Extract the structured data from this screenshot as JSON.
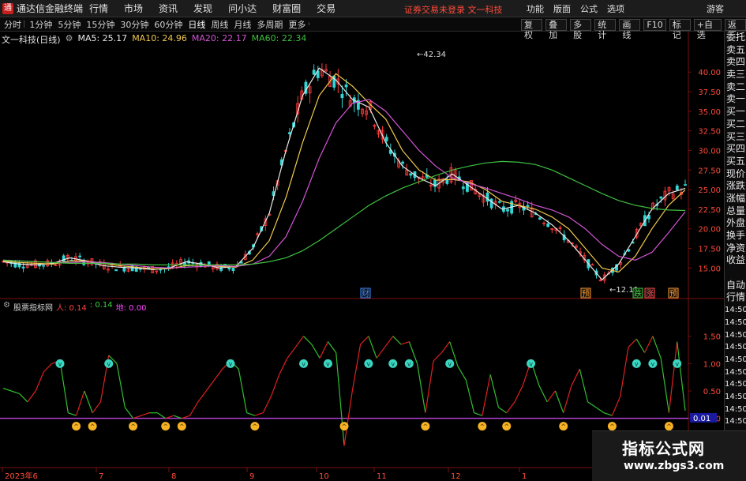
{
  "app": {
    "title": "通达信金融终端",
    "logo": "通"
  },
  "menu": [
    "行情",
    "市场",
    "资讯",
    "发现",
    "问小达",
    "财富圈",
    "交易"
  ],
  "login_warning": "证券交易未登录  文一科技",
  "right_menu": [
    "功能",
    "版面",
    "公式",
    "选项"
  ],
  "guest": "游客",
  "period_tabs": [
    "分时",
    "1分钟",
    "5分钟",
    "15分钟",
    "30分钟",
    "60分钟",
    "日线",
    "周线",
    "月线",
    "多周期",
    "更多"
  ],
  "active_period": "日线",
  "toolbar_buttons": [
    "复权",
    "叠加",
    "多股",
    "统计",
    "画线",
    "F10",
    "标记",
    "+自选",
    "返回"
  ],
  "stock": {
    "name": "文一科技(日线)"
  },
  "ma": {
    "ma5": "MA5: 25.17",
    "ma10": "MA10: 24.96",
    "ma20": "MA20: 22.17",
    "ma60": "MA60: 22.34"
  },
  "indicator": {
    "name": "股票指标网",
    "ren_label": "人: 0.14",
    "value2": ": 0.14",
    "di_label": "地: 0.00"
  },
  "side_panel": [
    "委托",
    "卖五",
    "卖四",
    "卖三",
    "卖二",
    "卖一",
    "买一",
    "买二",
    "买三",
    "买四",
    "买五",
    "现价",
    "涨跌",
    "涨幅",
    "总量",
    "外盘",
    "换手",
    "净资",
    "收益",
    "",
    "自动",
    "行情",
    "14:50",
    "14:50",
    "14:50",
    "14:50",
    "14:50",
    "14:50",
    "14:50",
    "14:50",
    "14:50",
    "14:50"
  ],
  "price_axis": [
    "40.00",
    "37.50",
    "35.00",
    "32.50",
    "30.00",
    "27.50",
    "25.00",
    "22.50",
    "20.00",
    "17.50",
    "15.00"
  ],
  "ind_axis": [
    "1.50",
    "1.00",
    "0.50",
    "0.00",
    "-0.50"
  ],
  "current_ind_value": "0.01",
  "high_label": "42.34",
  "low_label": "12.11",
  "event_tags": [
    "财",
    "预",
    "跌",
    "涨",
    "预"
  ],
  "time_axis": [
    "2023年6",
    "7",
    "8",
    "9",
    "10",
    "11",
    "12",
    "1"
  ],
  "watermark": {
    "title": "指标公式网",
    "url": "www.zbgs3.com"
  },
  "colors": {
    "up": "#ff3b3b",
    "down": "#33d6d6",
    "ma5": "#e8e8e8",
    "ma10": "#f2c94c",
    "ma20": "#d455d6",
    "ma60": "#3fbf3f",
    "signal_purple": "#b040d0"
  },
  "chart_data": [
    {
      "type": "candlestick",
      "title": "文一科技(日线)",
      "ylim": [
        12.11,
        42.34
      ],
      "y_ticks": [
        15,
        17.5,
        20,
        22.5,
        25,
        27.5,
        30,
        32.5,
        35,
        37.5,
        40
      ],
      "x_ticks": [
        "2023年6",
        "7",
        "8",
        "9",
        "10",
        "11",
        "12",
        "1"
      ],
      "series": [
        {
          "name": "MA5",
          "values": [
            15.8,
            15.5,
            15.4,
            15.6,
            16.3,
            15.9,
            15.3,
            15.1,
            15.0,
            14.8,
            15.0,
            15.8,
            15.5,
            15.0,
            15.2,
            17.5,
            22.0,
            30.0,
            37.0,
            40.5,
            39.0,
            36.5,
            35.5,
            31.0,
            28.0,
            26.5,
            25.5,
            27.0,
            25.5,
            24.0,
            22.5,
            23.0,
            22.0,
            20.5,
            18.5,
            16.0,
            13.5,
            15.5,
            19.0,
            22.5,
            24.5,
            25.17
          ]
        },
        {
          "name": "MA10",
          "values": [
            15.9,
            15.7,
            15.6,
            15.5,
            15.9,
            15.9,
            15.6,
            15.3,
            15.1,
            14.9,
            14.9,
            15.3,
            15.4,
            15.2,
            15.1,
            16.0,
            18.5,
            24.0,
            31.0,
            37.0,
            39.8,
            38.2,
            36.0,
            34.0,
            30.0,
            27.5,
            26.2,
            26.3,
            26.0,
            25.0,
            23.5,
            23.0,
            22.5,
            21.5,
            20.0,
            17.5,
            15.0,
            14.5,
            16.5,
            20.0,
            23.0,
            24.96
          ]
        },
        {
          "name": "MA20",
          "values": [
            16.0,
            15.9,
            15.8,
            15.7,
            15.7,
            15.8,
            15.7,
            15.5,
            15.3,
            15.1,
            15.0,
            15.1,
            15.2,
            15.3,
            15.2,
            15.5,
            16.5,
            19.0,
            23.5,
            29.0,
            33.5,
            36.0,
            36.5,
            35.0,
            32.5,
            30.0,
            28.0,
            26.5,
            25.8,
            25.2,
            24.5,
            23.8,
            23.0,
            22.4,
            21.5,
            20.0,
            18.0,
            16.5,
            16.0,
            17.0,
            19.5,
            22.17
          ]
        },
        {
          "name": "MA60",
          "values": [
            16.0,
            15.9,
            15.8,
            15.7,
            15.6,
            15.6,
            15.6,
            15.5,
            15.5,
            15.4,
            15.4,
            15.4,
            15.4,
            15.4,
            15.4,
            15.5,
            15.8,
            16.3,
            17.2,
            18.5,
            20.0,
            21.5,
            23.0,
            24.2,
            25.2,
            26.0,
            26.8,
            27.5,
            28.0,
            28.4,
            28.6,
            28.5,
            28.2,
            27.5,
            26.5,
            25.5,
            24.5,
            23.6,
            23.0,
            22.6,
            22.4,
            22.34
          ]
        }
      ]
    },
    {
      "type": "line",
      "title": "股票指标网",
      "ylim": [
        -0.5,
        1.5
      ],
      "y_ticks": [
        -0.5,
        0,
        0.5,
        1.0,
        1.5
      ],
      "series": [
        {
          "name": "人",
          "values": [
            0.55,
            0.5,
            0.45,
            0.3,
            0.5,
            0.85,
            1.0,
            1.05,
            0.1,
            0.05,
            0.5,
            0.1,
            0.3,
            1.15,
            1.0,
            0.2,
            0.0,
            0.05,
            0.1,
            0.1,
            0.0,
            0.05,
            0.0,
            0.05,
            0.3,
            0.5,
            0.7,
            0.9,
            1.05,
            0.9,
            0.1,
            0.05,
            0.1,
            0.4,
            0.8,
            1.1,
            1.3,
            1.5,
            1.35,
            1.1,
            1.4,
            1.2,
            -0.5,
            0.5,
            1.35,
            1.5,
            1.1,
            1.3,
            1.5,
            1.35,
            1.4,
            1.0,
            0.1,
            1.05,
            1.2,
            1.4,
            0.95,
            0.7,
            0.1,
            0.05,
            0.8,
            0.2,
            0.1,
            0.3,
            0.6,
            1.05,
            0.6,
            0.3,
            0.5,
            0.1,
            0.6,
            0.9,
            0.3,
            0.2,
            0.1,
            0.05,
            0.4,
            1.3,
            1.45,
            1.2,
            1.5,
            1.1,
            0.1,
            1.4,
            0.14
          ]
        }
      ]
    }
  ]
}
